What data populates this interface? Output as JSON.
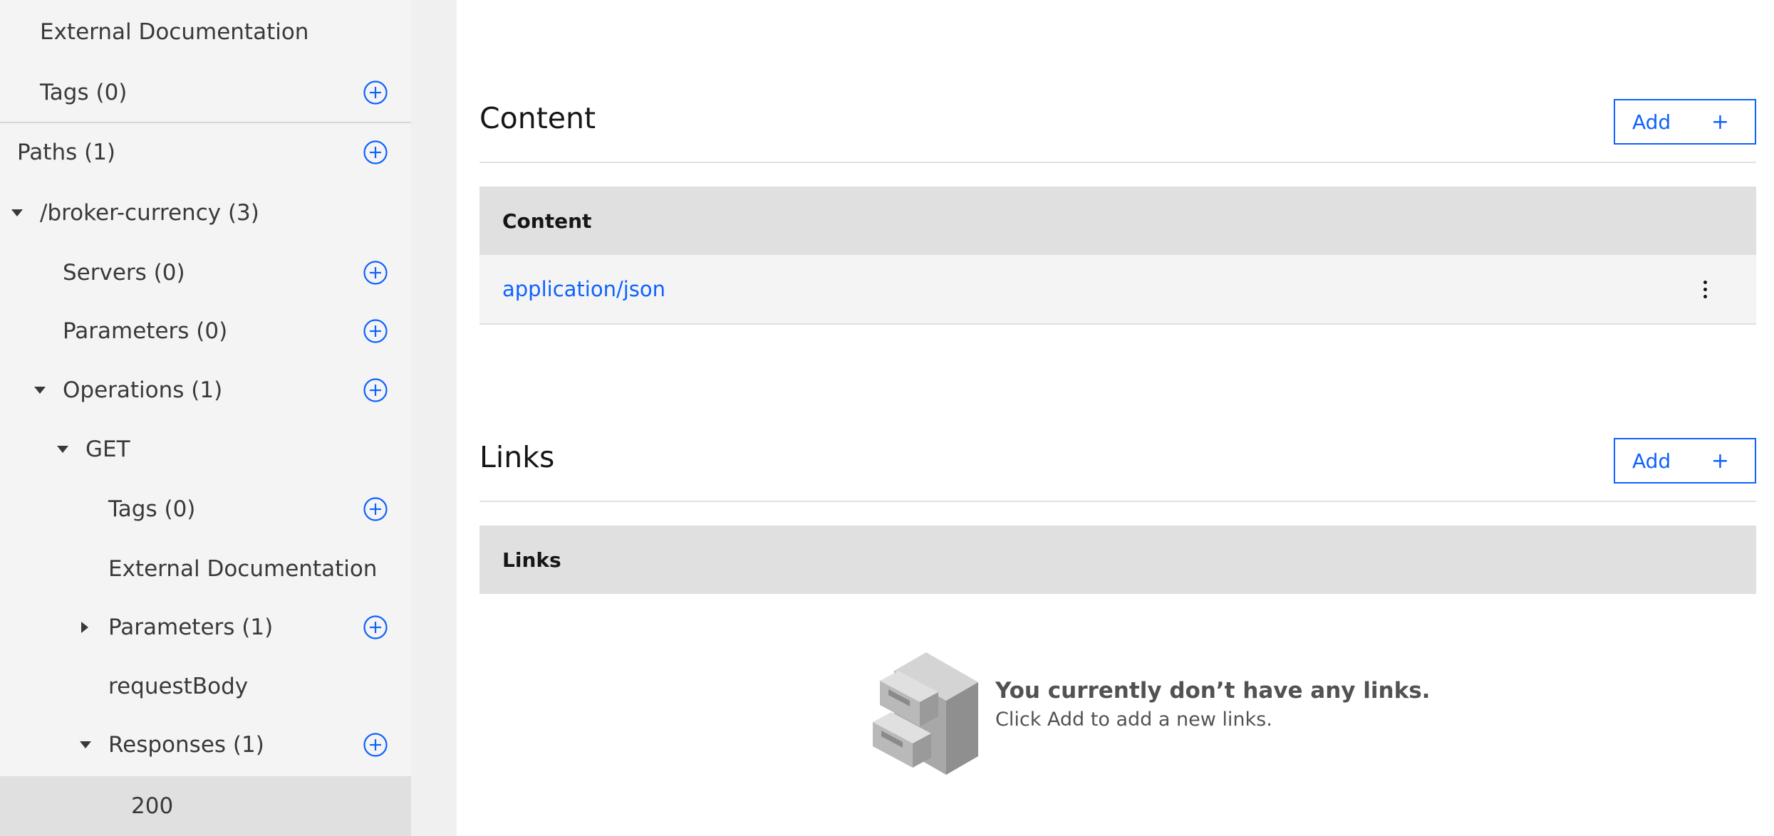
{
  "sidebar": {
    "items": [
      {
        "label": "External Documentation"
      },
      {
        "label": "Tags (0)"
      },
      {
        "label": "Paths (1)"
      },
      {
        "label": "/broker-currency (3)"
      },
      {
        "label": "Servers (0)"
      },
      {
        "label": "Parameters (0)"
      },
      {
        "label": "Operations (1)"
      },
      {
        "label": "GET"
      },
      {
        "label": "Tags (0)"
      },
      {
        "label": "External Documentation"
      },
      {
        "label": "Parameters (1)"
      },
      {
        "label": "requestBody"
      },
      {
        "label": "Responses (1)"
      },
      {
        "label": "200"
      }
    ]
  },
  "content_section": {
    "title": "Content",
    "add_label": "Add",
    "add_icon": "+",
    "table_header": "Content",
    "rows": [
      {
        "value": "application/json"
      }
    ]
  },
  "links_section": {
    "title": "Links",
    "add_label": "Add",
    "add_icon": "+",
    "table_header": "Links",
    "empty_title": "You currently don’t have any links.",
    "empty_subtitle": "Click Add to add a new links."
  },
  "colors": {
    "accent": "#0f62fe",
    "sidebar_bg": "#f4f4f4",
    "selected_bg": "#e0e0e0",
    "table_header_bg": "#e0e0e0"
  }
}
